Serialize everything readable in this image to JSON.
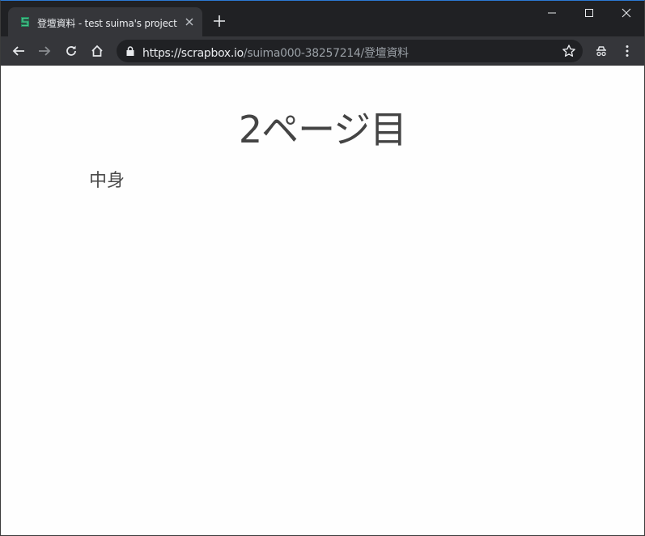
{
  "tab": {
    "title": "登壇資料 - test suima's project"
  },
  "window_controls": {
    "minimize": "minimize",
    "maximize": "maximize",
    "close": "close"
  },
  "address_bar": {
    "url_host": "https://scrapbox.io",
    "url_path": "/suima000-38257214/登壇資料"
  },
  "page": {
    "title": "2ページ目",
    "lines": [
      "中身"
    ]
  },
  "colors": {
    "titlebar": "#202124",
    "toolbar": "#35363a",
    "favicon_dark": "#1e8c5e",
    "favicon_light": "#51c08a"
  },
  "icons": [
    "scrapbox-favicon-icon",
    "close-icon",
    "plus-icon",
    "back-arrow-icon",
    "forward-arrow-icon",
    "reload-icon",
    "home-icon",
    "lock-icon",
    "star-icon",
    "incognito-icon",
    "more-vert-icon"
  ]
}
